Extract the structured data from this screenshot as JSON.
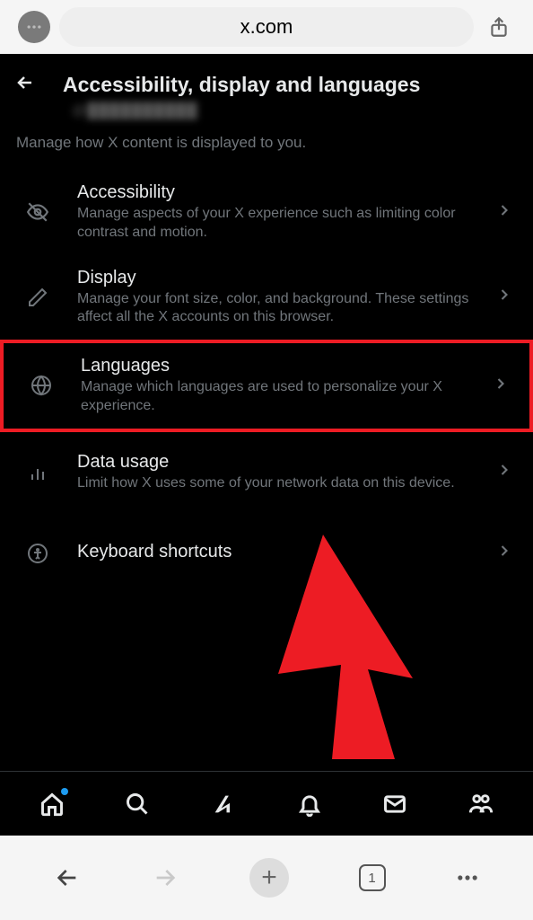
{
  "browser": {
    "url": "x.com",
    "tab_count": "1"
  },
  "page": {
    "title": "Accessibility, display and languages",
    "subtitle": "Manage how X content is displayed to you."
  },
  "settings": [
    {
      "title": "Accessibility",
      "desc": "Manage aspects of your X experience such as limiting color contrast and motion."
    },
    {
      "title": "Display",
      "desc": "Manage your font size, color, and background. These settings affect all the X accounts on this browser."
    },
    {
      "title": "Languages",
      "desc": "Manage which languages are used to personalize your X experience."
    },
    {
      "title": "Data usage",
      "desc": "Limit how X uses some of your network data on this device."
    },
    {
      "title": "Keyboard shortcuts",
      "desc": ""
    }
  ]
}
